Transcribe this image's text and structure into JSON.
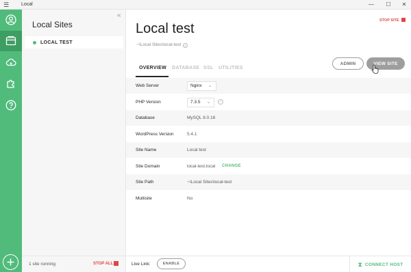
{
  "window": {
    "title": "Local",
    "menu_icon": "hamburger-icon",
    "controls": {
      "minimize": "—",
      "maximize": "☐",
      "close": "✕"
    }
  },
  "rail": {
    "items": [
      {
        "icon": "user-icon"
      },
      {
        "icon": "sites-icon",
        "active": true
      },
      {
        "icon": "cloud-icon"
      },
      {
        "icon": "addons-icon"
      },
      {
        "icon": "help-icon"
      }
    ],
    "add_icon": "plus-icon"
  },
  "sites_panel": {
    "collapse_glyph": "«",
    "heading": "Local Sites",
    "sites": [
      {
        "name": "LOCAL TEST",
        "status_color": "#51bb7b"
      }
    ],
    "running_text": "1 site running",
    "stop_all_label": "STOP ALL"
  },
  "site": {
    "stop_label": "STOP SITE",
    "title": "Local test",
    "path": "~\\Local Sites\\local-test",
    "tabs": [
      "OVERVIEW",
      "DATABASE",
      "SSL",
      "UTILITIES"
    ],
    "active_tab": "OVERVIEW",
    "admin_label": "ADMIN",
    "view_site_label": "VIEW SITE",
    "details": {
      "web_server": {
        "label": "Web Server",
        "value": "Nginx"
      },
      "php_version": {
        "label": "PHP Version",
        "value": "7.3.5"
      },
      "database": {
        "label": "Database",
        "value": "MySQL 8.0.16"
      },
      "wordpress_version": {
        "label": "WordPress Version",
        "value": "5.4.1"
      },
      "site_name": {
        "label": "Site Name",
        "value": "Local test"
      },
      "site_domain": {
        "label": "Site Domain",
        "value": "local-test.local",
        "change_label": "CHANGE"
      },
      "site_path": {
        "label": "Site Path",
        "value": "~\\Local Sites\\local-test"
      },
      "multisite": {
        "label": "Multisite",
        "value": "No"
      }
    }
  },
  "footer": {
    "live_link_label": "Live Link:",
    "enable_label": "ENABLE",
    "connect_host_label": "CONNECT HOST",
    "connect_icon": "hourglass-icon"
  },
  "colors": {
    "accent": "#51bb7b",
    "rail_active": "#3e9d62",
    "stop": "#e04646",
    "button_gray": "#9e9e9e"
  }
}
